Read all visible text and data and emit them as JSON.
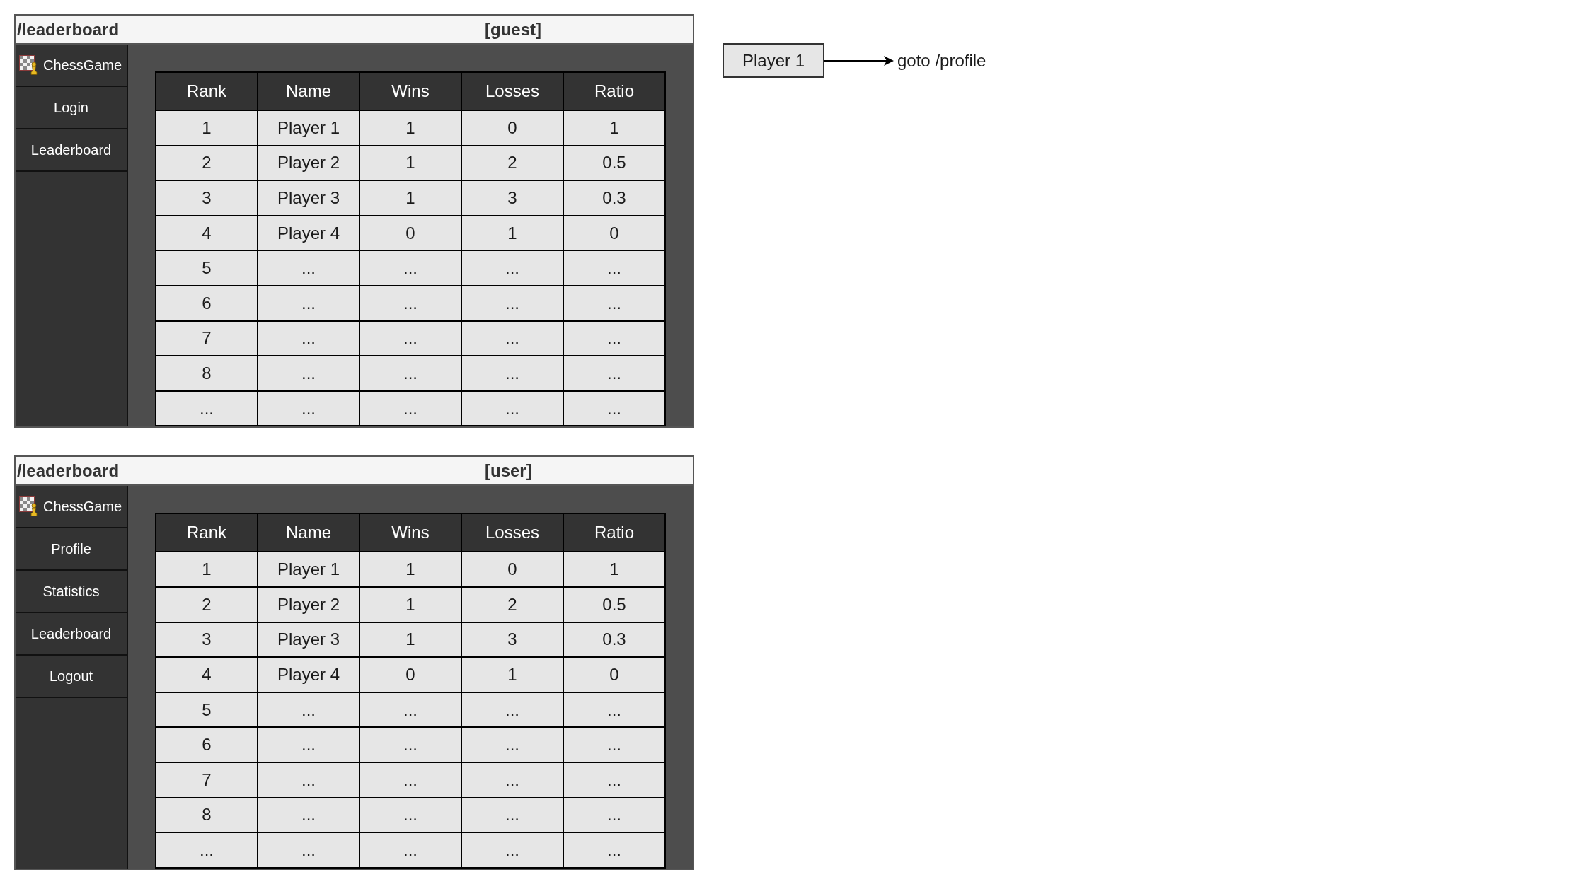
{
  "screens": [
    {
      "route": "/leaderboard",
      "role": "[guest]",
      "brand": "ChessGame",
      "nav": [
        "Login",
        "Leaderboard"
      ],
      "table": {
        "columns": [
          "Rank",
          "Name",
          "Wins",
          "Losses",
          "Ratio"
        ],
        "rows": [
          [
            "1",
            "Player 1",
            "1",
            "0",
            "1"
          ],
          [
            "2",
            "Player 2",
            "1",
            "2",
            "0.5"
          ],
          [
            "3",
            "Player 3",
            "1",
            "3",
            "0.3"
          ],
          [
            "4",
            "Player 4",
            "0",
            "1",
            "0"
          ],
          [
            "5",
            "...",
            "...",
            "...",
            "..."
          ],
          [
            "6",
            "...",
            "...",
            "...",
            "..."
          ],
          [
            "7",
            "...",
            "...",
            "...",
            "..."
          ],
          [
            "8",
            "...",
            "...",
            "...",
            "..."
          ],
          [
            "...",
            "...",
            "...",
            "...",
            "..."
          ]
        ]
      }
    },
    {
      "route": "/leaderboard",
      "role": "[user]",
      "brand": "ChessGame",
      "nav": [
        "Profile",
        "Statistics",
        "Leaderboard",
        "Logout"
      ],
      "table": {
        "columns": [
          "Rank",
          "Name",
          "Wins",
          "Losses",
          "Ratio"
        ],
        "rows": [
          [
            "1",
            "Player 1",
            "1",
            "0",
            "1"
          ],
          [
            "2",
            "Player 2",
            "1",
            "2",
            "0.5"
          ],
          [
            "3",
            "Player 3",
            "1",
            "3",
            "0.3"
          ],
          [
            "4",
            "Player 4",
            "0",
            "1",
            "0"
          ],
          [
            "5",
            "...",
            "...",
            "...",
            "..."
          ],
          [
            "6",
            "...",
            "...",
            "...",
            "..."
          ],
          [
            "7",
            "...",
            "...",
            "...",
            "..."
          ],
          [
            "8",
            "...",
            "...",
            "...",
            "..."
          ],
          [
            "...",
            "...",
            "...",
            "...",
            "..."
          ]
        ]
      }
    }
  ],
  "annotation": {
    "node_label": "Player 1",
    "action": "goto /profile"
  }
}
